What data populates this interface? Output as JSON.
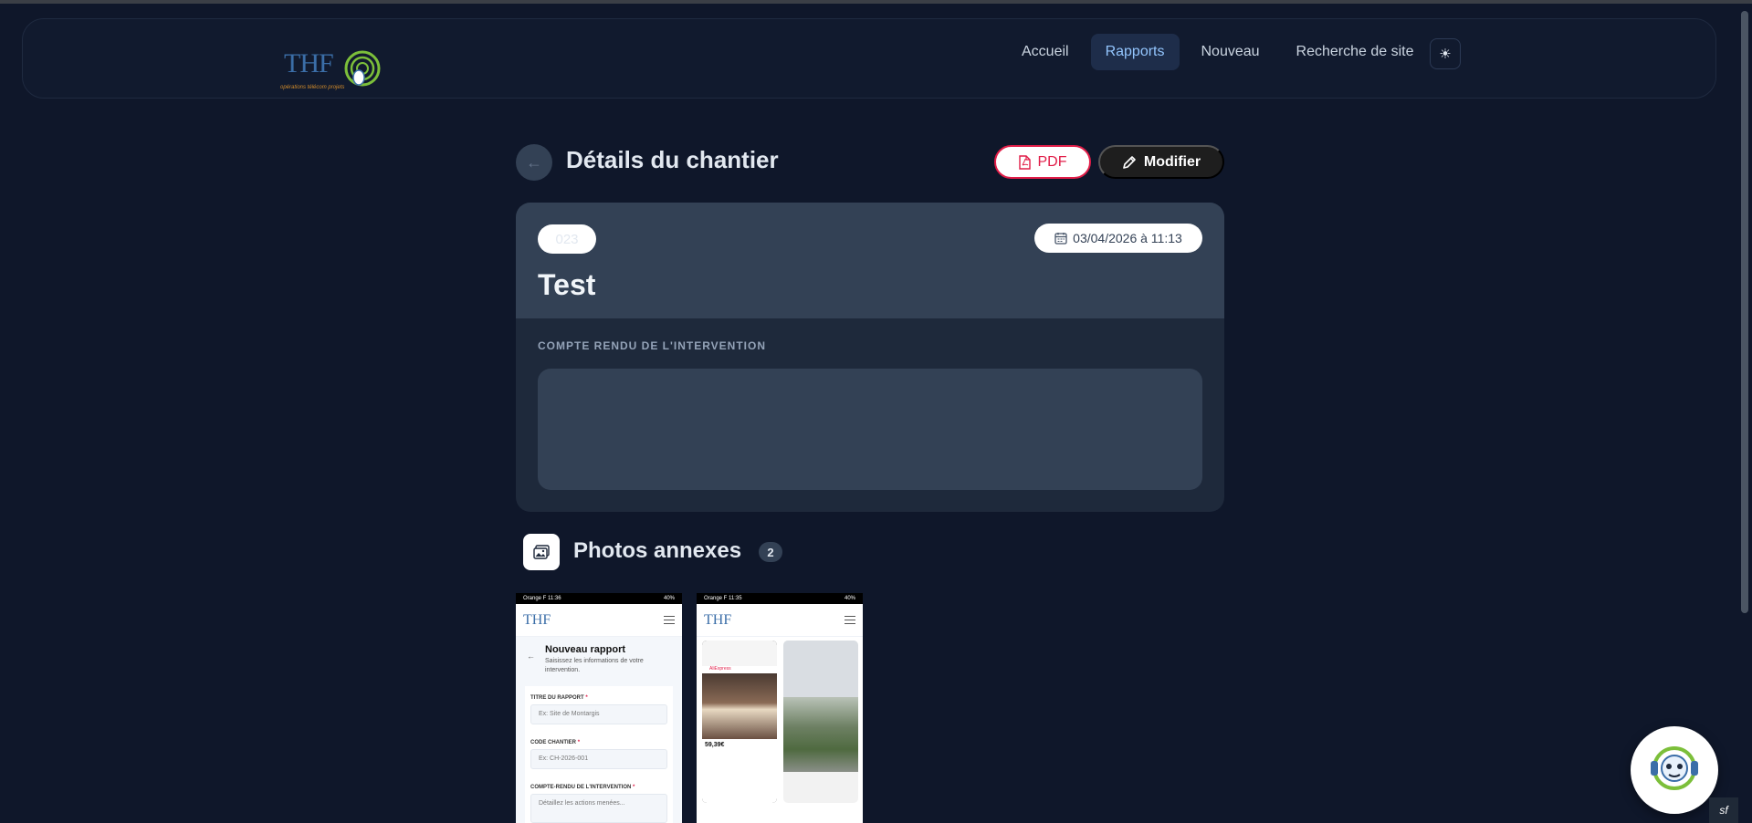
{
  "header": {
    "logo_text": "THF",
    "logo_tagline": "opérations télécom projets",
    "nav": [
      {
        "label": "Accueil",
        "active": false
      },
      {
        "label": "Rapports",
        "active": true
      },
      {
        "label": "Nouveau",
        "active": false
      },
      {
        "label": "Recherche de site",
        "active": false
      }
    ],
    "theme_icon": "sun-icon"
  },
  "page": {
    "back_icon": "arrow-left-icon",
    "title": "Détails du chantier",
    "pdf_label": "PDF",
    "edit_label": "Modifier"
  },
  "report": {
    "code": "023",
    "date": "03/04/2026 à 11:13",
    "title": "Test",
    "section_label": "COMPTE RENDU DE L'INTERVENTION",
    "content": ""
  },
  "photos": {
    "title": "Photos annexes",
    "count": "2",
    "items": [
      {
        "status_left": "Orange F 11:36",
        "status_right": "40%",
        "screen_title": "Nouveau rapport",
        "screen_subtitle": "Saisissez les informations de votre intervention.",
        "fields": [
          {
            "label": "TITRE DU RAPPORT",
            "placeholder": "Ex: Site de Montargis"
          },
          {
            "label": "CODE CHANTIER",
            "placeholder": "Ex: CH-2026-001"
          },
          {
            "label": "COMPTE-RENDU DE L'INTERVENTION",
            "placeholder": "Détaillez les actions menées..."
          }
        ]
      },
      {
        "status_left": "Orange F 11:35",
        "status_right": "40%",
        "store": "AliExpress",
        "price": "59,39€"
      }
    ]
  },
  "colors": {
    "background": "#0f172a",
    "nav_active": "#93c5fd",
    "pdf_accent": "#e11d48",
    "card_header": "#334155"
  }
}
